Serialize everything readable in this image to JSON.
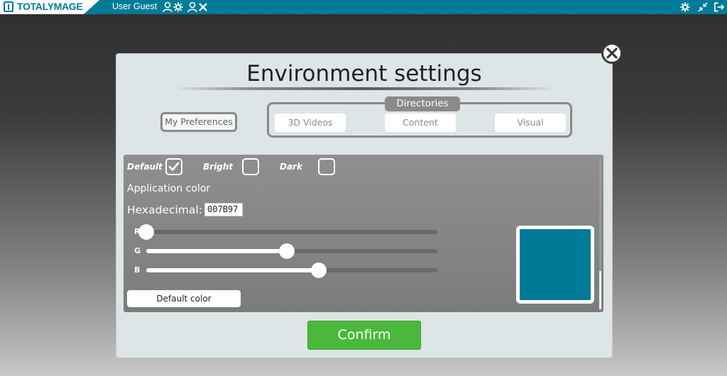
{
  "topbar": {
    "brand": "TOTALYMAGE",
    "user": "User Guest",
    "icons": [
      "user-settings-icon",
      "user-remove-icon",
      "gear-icon",
      "collapse-icon",
      "logout-icon"
    ],
    "color": "#007B97"
  },
  "modal": {
    "title": "Environment settings",
    "my_preferences": "My Preferences",
    "directories": {
      "label": "Directories",
      "items": [
        "3D Videos",
        "Content",
        "Visual"
      ]
    },
    "confirm": "Confirm"
  },
  "settings": {
    "themes": [
      {
        "label": "Default",
        "checked": true
      },
      {
        "label": "Bright",
        "checked": false
      },
      {
        "label": "Dark",
        "checked": false
      }
    ],
    "app_color_label": "Application color",
    "hex_label": "Hexadecimal:",
    "hex_value": "007B97",
    "channels": [
      {
        "label": "R",
        "value": 0
      },
      {
        "label": "G",
        "value": 123
      },
      {
        "label": "B",
        "value": 151
      }
    ],
    "channel_max": 255,
    "default_color_button": "Default color",
    "swatch_color": "#007B97"
  }
}
